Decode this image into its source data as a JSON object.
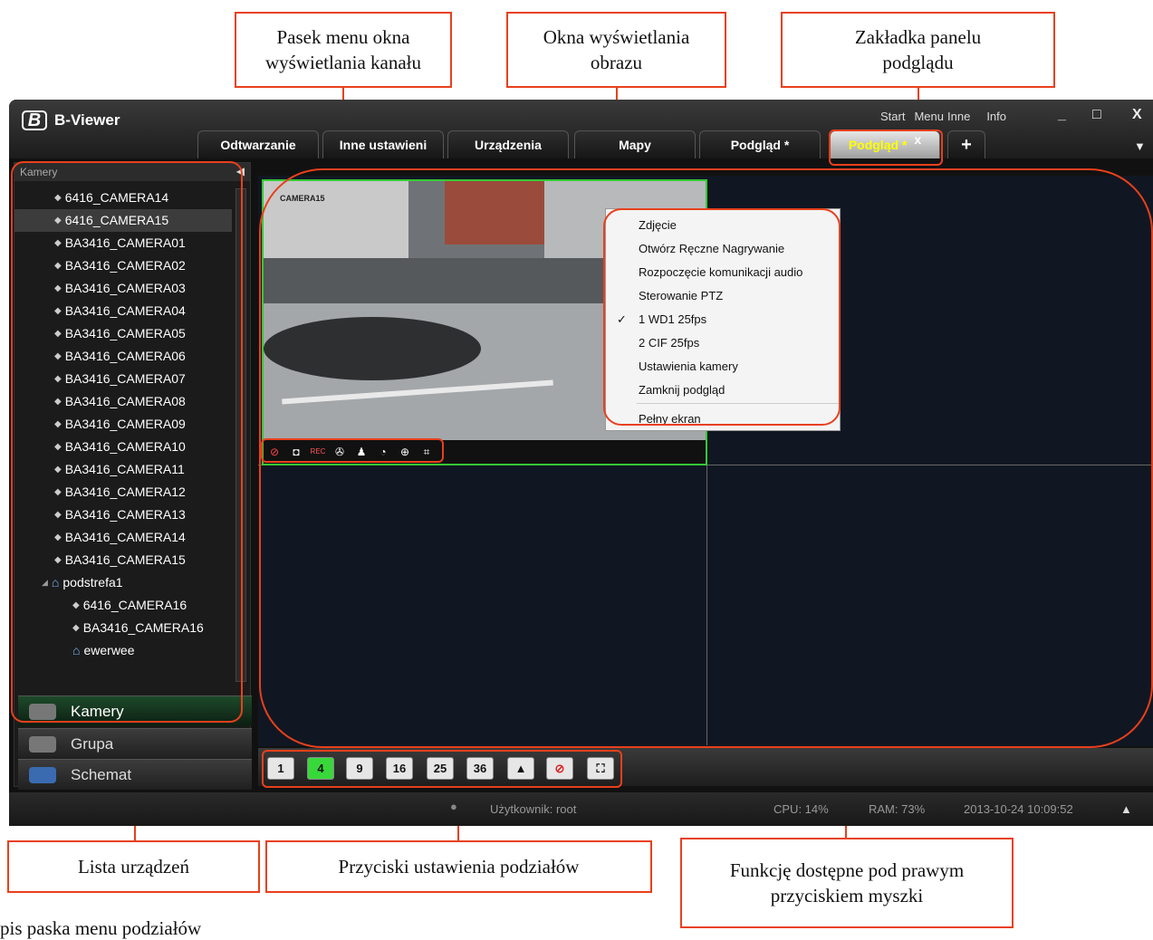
{
  "callouts": {
    "menubar": [
      "Pasek menu okna",
      "wyświetlania kanału"
    ],
    "windows": [
      "Okna wyświetlania",
      "obrazu"
    ],
    "tabpanel": [
      "Zakładka panelu",
      "podglądu"
    ],
    "devices": "Lista urządzeń",
    "splitbuttons": "Przyciski ustawienia podziałów",
    "rightclick": [
      "Funkcję dostępne pod prawym",
      "przyciskiem myszki"
    ],
    "bottomtext": "pis paska menu podziałów"
  },
  "app": {
    "name": "B-Viewer",
    "logo": "B",
    "topmenu": [
      "Start",
      "Menu",
      "Inne",
      "Info"
    ],
    "window_buttons": [
      "_",
      "□",
      "X"
    ],
    "tabs": [
      "Odtwarzanie",
      "Inne ustawieni",
      "Urządzenia",
      "Mapy",
      "Podgląd *",
      "Podgląd *"
    ],
    "tab_close": "x",
    "add_tab": "+",
    "dropdown": "▼"
  },
  "left_panel": {
    "header": "Kamery",
    "collapse": "◀",
    "items": [
      "6416_CAMERA14",
      "6416_CAMERA15",
      "BA3416_CAMERA01",
      "BA3416_CAMERA02",
      "BA3416_CAMERA03",
      "BA3416_CAMERA04",
      "BA3416_CAMERA05",
      "BA3416_CAMERA06",
      "BA3416_CAMERA07",
      "BA3416_CAMERA08",
      "BA3416_CAMERA09",
      "BA3416_CAMERA10",
      "BA3416_CAMERA11",
      "BA3416_CAMERA12",
      "BA3416_CAMERA13",
      "BA3416_CAMERA14",
      "BA3416_CAMERA15",
      "podstrefa1",
      "6416_CAMERA16",
      "BA3416_CAMERA16",
      "ewerwee"
    ],
    "nav": [
      "Kamery",
      "Grupa",
      "Schemat"
    ]
  },
  "video": {
    "cam_label": "CAMERA15",
    "iconbar": [
      "⊘",
      "◘",
      "REC",
      "✇",
      "♟",
      "◔",
      "⊕",
      "⌗"
    ]
  },
  "context_menu": [
    "Zdjęcie",
    "Otwórz Ręczne Nagrywanie",
    "Rozpoczęcie komunikacji audio",
    "Sterowanie PTZ",
    "1 WD1 25fps",
    "2 CIF 25fps",
    "Ustawienia kamery",
    "Zamknij podgląd",
    "Pełny ekran"
  ],
  "checkmark": "✓",
  "layout_buttons": [
    "1",
    "4",
    "9",
    "16",
    "25",
    "36",
    "▲",
    "⊘",
    "⛶"
  ],
  "status": {
    "user": "Użytkownik: root",
    "cpu": "CPU: 14%",
    "ram": "RAM: 73%",
    "datetime": "2013-10-24 10:09:52",
    "up": "▲"
  }
}
